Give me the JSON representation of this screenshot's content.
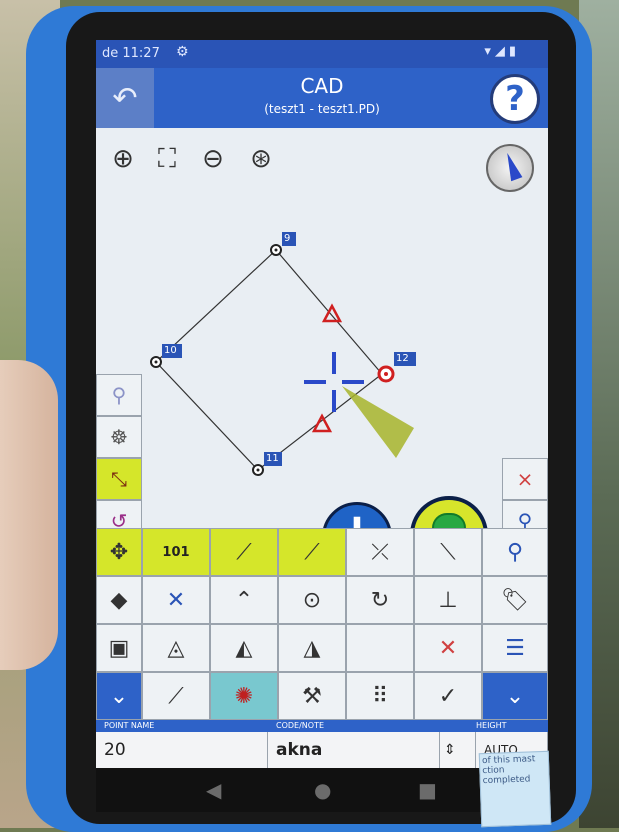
{
  "status_bar": {
    "time": "de 11:27",
    "icons_text": "▾◢▮"
  },
  "title_bar": {
    "title": "CAD",
    "subtitle": "(teszt1 - teszt1.PD)",
    "help_label": "?"
  },
  "map_tools": [
    "zoom-in-icon",
    "zoom-extents-icon",
    "zoom-out-icon",
    "zoom-window-icon"
  ],
  "points": [
    {
      "label": "9"
    },
    {
      "label": "10"
    },
    {
      "label": "11"
    },
    {
      "label": "12"
    }
  ],
  "toolbar": {
    "row1": {
      "point_label": "101"
    }
  },
  "fields": {
    "point_name_label": "POINT NAME",
    "code_note_label": "CODE/NOTE",
    "height_label": "HEIGHT",
    "point_name_value": "20",
    "code_value": "akna",
    "height_value": "AUTO"
  },
  "sticker_text": "of this mast\nction completed"
}
